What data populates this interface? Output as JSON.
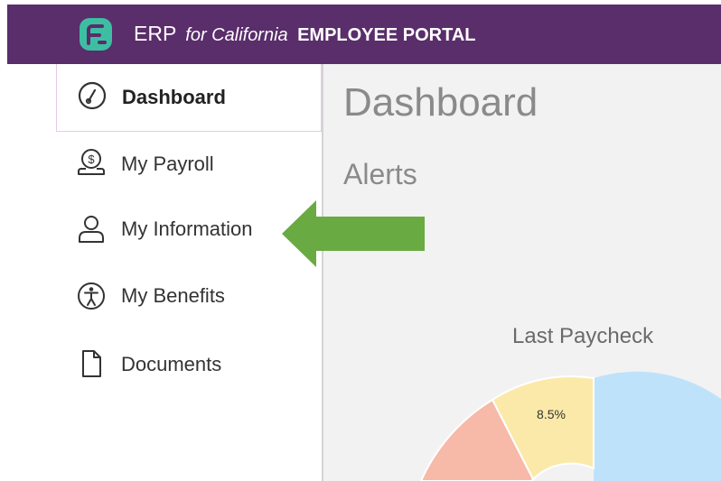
{
  "header": {
    "brand_erp": "ERP",
    "brand_for": "for California",
    "brand_portal": "EMPLOYEE PORTAL",
    "bg_color": "#5a2d6b",
    "logo_color": "#3dbea3"
  },
  "sidebar": {
    "items": [
      {
        "label": "Dashboard",
        "icon": "dashboard-gauge-icon",
        "active": true
      },
      {
        "label": "My Payroll",
        "icon": "payroll-dollar-icon",
        "active": false
      },
      {
        "label": "My Information",
        "icon": "user-icon",
        "active": false
      },
      {
        "label": "My Benefits",
        "icon": "accessibility-person-icon",
        "active": false
      },
      {
        "label": "Documents",
        "icon": "document-icon",
        "active": false
      }
    ]
  },
  "main": {
    "title": "Dashboard",
    "alerts_title": "Alerts"
  },
  "chart_data": {
    "type": "pie",
    "title": "Last Paycheck",
    "slices": [
      {
        "label": "8.5%",
        "value": 8.5,
        "color": "#fbe9a9"
      },
      {
        "label": "",
        "value": null,
        "color": "#f7b9a8"
      },
      {
        "label": "",
        "value": null,
        "color": "#bfe2fb"
      }
    ]
  },
  "annotation": {
    "arrow_color": "#6aaa42",
    "arrow_target": "My Information"
  }
}
